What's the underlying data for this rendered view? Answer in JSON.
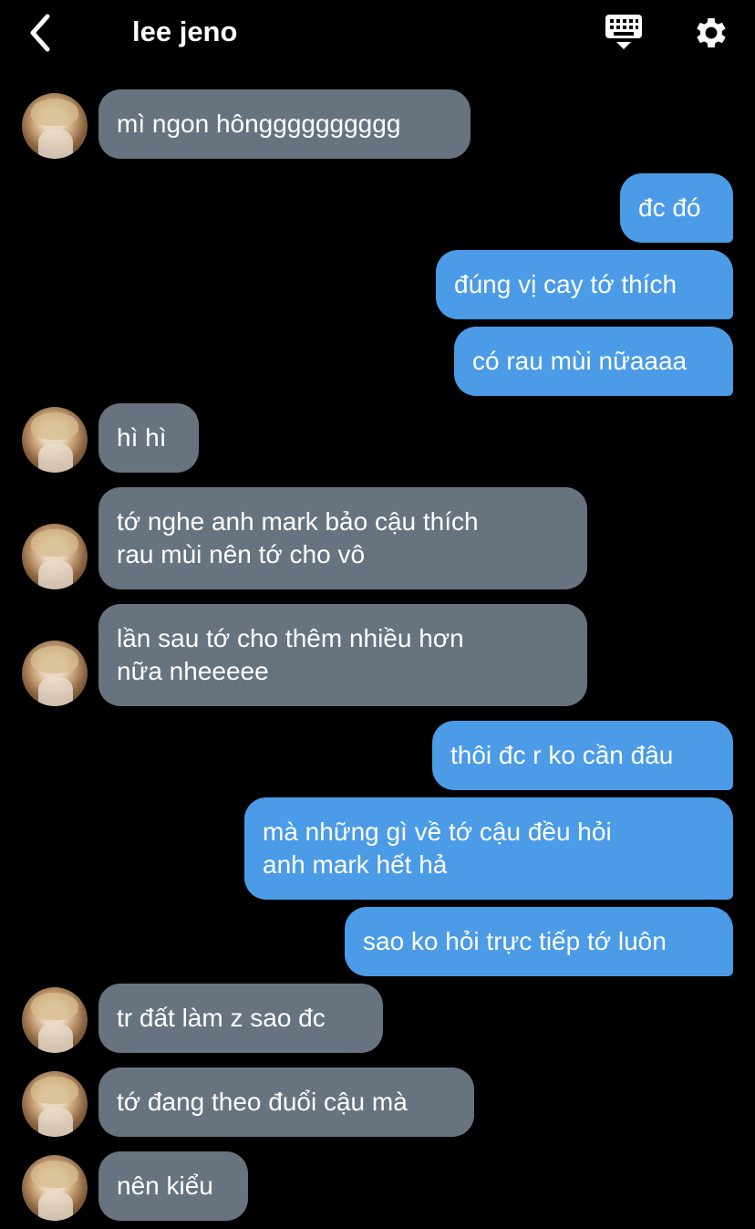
{
  "header": {
    "title": "lee jeno",
    "icons": [
      "back-chevron-icon",
      "keyboard-icon",
      "gear-icon"
    ]
  },
  "messages": [
    {
      "side": "in",
      "text": "mì ngon hôngggggggggg"
    },
    {
      "side": "out",
      "text": "đc đó"
    },
    {
      "side": "out",
      "text": "đúng vị cay tớ thích"
    },
    {
      "side": "out",
      "text": "có rau mùi nữaaaa"
    },
    {
      "side": "in",
      "text": "hì hì"
    },
    {
      "side": "in",
      "text": "tớ nghe anh mark bảo cậu thích\nrau mùi nên tớ cho vô"
    },
    {
      "side": "in",
      "text": "lần sau tớ cho thêm nhiều hơn\nnữa nheeeee"
    },
    {
      "side": "out",
      "text": "thôi đc r ko cần đâu"
    },
    {
      "side": "out",
      "text": "mà những gì về tớ cậu đều hỏi\nanh mark hết hả"
    },
    {
      "side": "out",
      "text": "sao ko hỏi trực tiếp tớ luôn"
    },
    {
      "side": "in",
      "text": "tr đất làm z sao đc"
    },
    {
      "side": "in",
      "text": "tớ đang theo đuổi cậu mà"
    },
    {
      "side": "in",
      "text": "nên kiểu"
    }
  ],
  "colors": {
    "background": "#000000",
    "incoming_bubble": "#687380",
    "outgoing_bubble": "#4b9be6",
    "text": "#ffffff"
  }
}
